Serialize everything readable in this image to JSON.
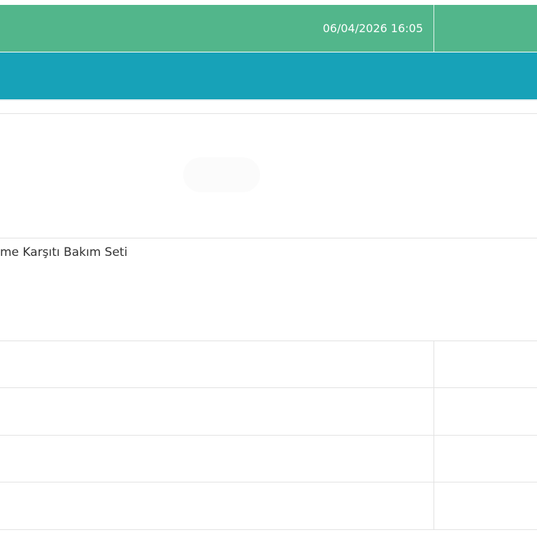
{
  "header": {
    "datetime": "06/04/2026 16:05"
  },
  "product": {
    "title": "me Karşıtı Bakım Seti"
  },
  "table": {
    "rows": [
      {
        "left": "",
        "right": ""
      },
      {
        "left": "",
        "right": ""
      },
      {
        "left": "",
        "right": ""
      },
      {
        "left": "",
        "right": ""
      }
    ]
  },
  "colors": {
    "topbar": "#52b68b",
    "band": "#17a2b8",
    "border": "#e2e2e2",
    "text": "#333333"
  }
}
